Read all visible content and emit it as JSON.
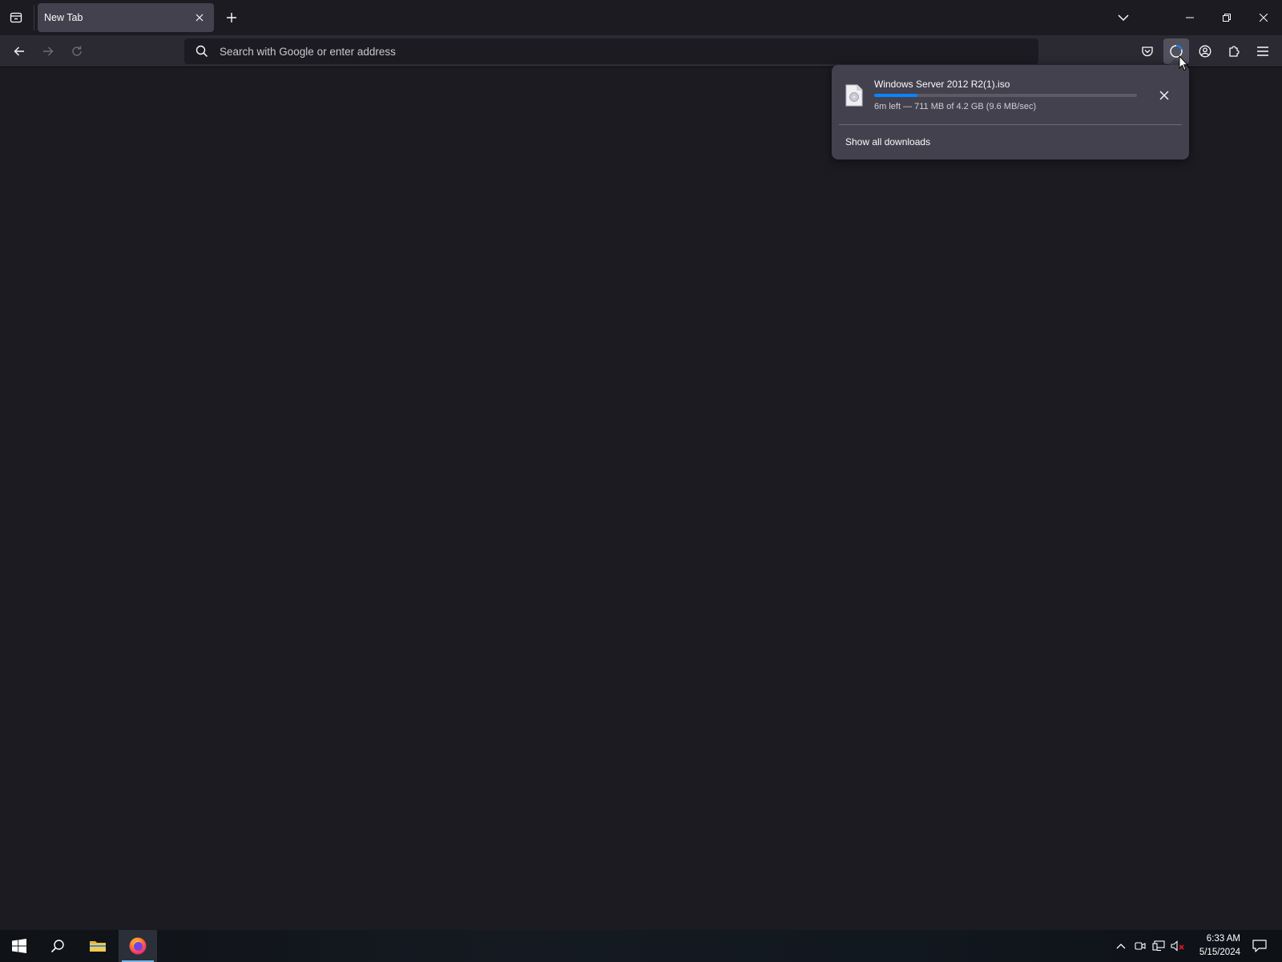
{
  "tab": {
    "title": "New Tab",
    "close_tooltip": "Close Tab"
  },
  "urlbar": {
    "placeholder": "Search with Google or enter address",
    "value": ""
  },
  "toolbar_icons": [
    "back-icon",
    "forward-icon",
    "reload-icon",
    "pocket-icon",
    "downloads-icon",
    "account-icon",
    "extensions-icon",
    "menu-icon"
  ],
  "downloads_panel": {
    "item": {
      "filename": "Windows Server 2012 R2(1).iso",
      "status": "6m left — 711 MB of 4.2 GB (9.6 MB/sec)",
      "progress_fraction": 0.165
    },
    "show_all_label": "Show all downloads"
  },
  "taskbar": {
    "time": "6:33 AM",
    "date": "5/15/2024",
    "pinned": [
      "start-icon",
      "search-icon",
      "file-explorer-icon",
      "firefox-icon"
    ]
  },
  "colors": {
    "accent": "#0a84ff",
    "content_background": "#1c1b22",
    "toolbar_background": "#2b2a33",
    "panel_background": "#42414d"
  }
}
